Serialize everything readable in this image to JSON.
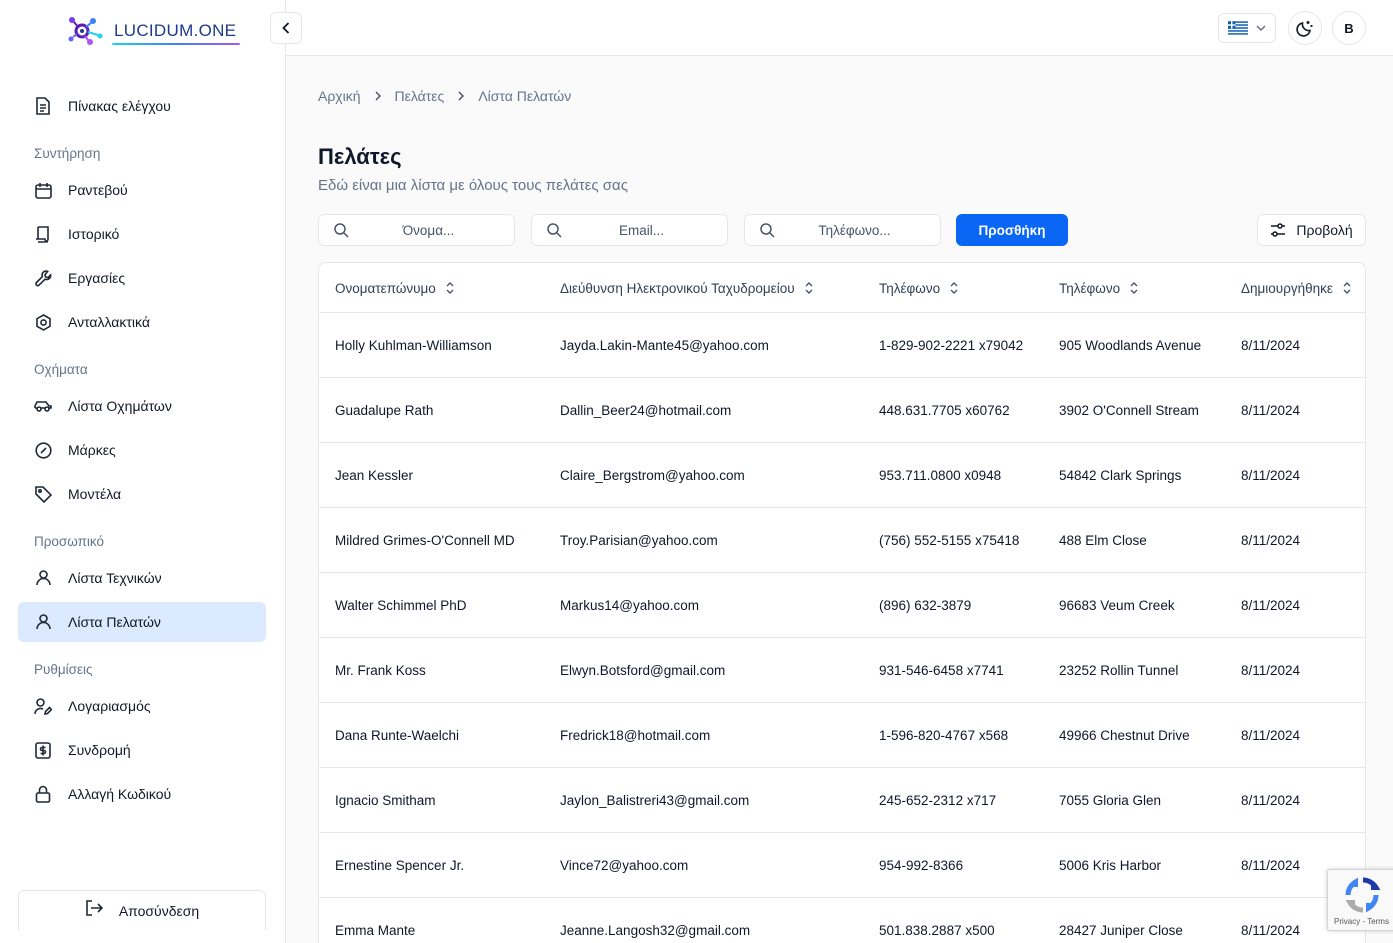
{
  "brand": {
    "name": "LUCIDUM.ONE"
  },
  "sidebar": {
    "dashboard": "Πίνακας ελέγχου",
    "sections": {
      "maintenance": "Συντήρηση",
      "vehicles": "Οχήματα",
      "staff": "Προσωπικό",
      "settings": "Ρυθμίσεις"
    },
    "maintenance_items": [
      "Ραντεβού",
      "Ιστορικό",
      "Εργασίες",
      "Ανταλλακτικά"
    ],
    "vehicle_items": [
      "Λίστα Οχημάτων",
      "Μάρκες",
      "Μοντέλα"
    ],
    "staff_items": [
      "Λίστα Τεχνικών",
      "Λίστα Πελατών"
    ],
    "settings_items": [
      "Λογαριασμός",
      "Συνδρομή",
      "Αλλαγή Κωδικού"
    ],
    "logout": "Αποσύνδεση"
  },
  "header": {
    "avatar_initial": "B"
  },
  "breadcrumb": [
    "Αρχική",
    "Πελάτες",
    "Λίστα Πελατών"
  ],
  "page": {
    "title": "Πελάτες",
    "subtitle": "Εδώ είναι μια λίστα με όλους τους πελάτες σας"
  },
  "filters": {
    "name_placeholder": "Όνομα...",
    "email_placeholder": "Email...",
    "phone_placeholder": "Τηλέφωνο..."
  },
  "actions": {
    "add": "Προσθήκη",
    "view": "Προβολή"
  },
  "table": {
    "columns": [
      "Ονοματεπώνυμο",
      "Διεύθυνση Ηλεκτρονικού Ταχυδρομείου",
      "Τηλέφωνο",
      "Τηλέφωνο",
      "Δημιουργήθηκε"
    ],
    "rows": [
      [
        "Holly Kuhlman-Williamson",
        "Jayda.Lakin-Mante45@yahoo.com",
        "1-829-902-2221 x79042",
        "905 Woodlands Avenue",
        "8/11/2024"
      ],
      [
        "Guadalupe Rath",
        "Dallin_Beer24@hotmail.com",
        "448.631.7705 x60762",
        "3902 O'Connell Stream",
        "8/11/2024"
      ],
      [
        "Jean Kessler",
        "Claire_Bergstrom@yahoo.com",
        "953.711.0800 x0948",
        "54842 Clark Springs",
        "8/11/2024"
      ],
      [
        "Mildred Grimes-O'Connell MD",
        "Troy.Parisian@yahoo.com",
        "(756) 552-5155 x75418",
        "488 Elm Close",
        "8/11/2024"
      ],
      [
        "Walter Schimmel PhD",
        "Markus14@yahoo.com",
        "(896) 632-3879",
        "96683 Veum Creek",
        "8/11/2024"
      ],
      [
        "Mr. Frank Koss",
        "Elwyn.Botsford@gmail.com",
        "931-546-6458 x7741",
        "23252 Rollin Tunnel",
        "8/11/2024"
      ],
      [
        "Dana Runte-Waelchi",
        "Fredrick18@hotmail.com",
        "1-596-820-4767 x568",
        "49966 Chestnut Drive",
        "8/11/2024"
      ],
      [
        "Ignacio Smitham",
        "Jaylon_Balistreri43@gmail.com",
        "245-652-2312 x717",
        "7055 Gloria Glen",
        "8/11/2024"
      ],
      [
        "Ernestine Spencer Jr.",
        "Vince72@yahoo.com",
        "954-992-8366",
        "5006 Kris Harbor",
        "8/11/2024"
      ],
      [
        "Emma Mante",
        "Jeanne.Langosh32@gmail.com",
        "501.838.2887 x500",
        "28427 Juniper Close",
        "8/11/2024"
      ]
    ]
  },
  "recaptcha": {
    "text": "Privacy - Terms"
  }
}
